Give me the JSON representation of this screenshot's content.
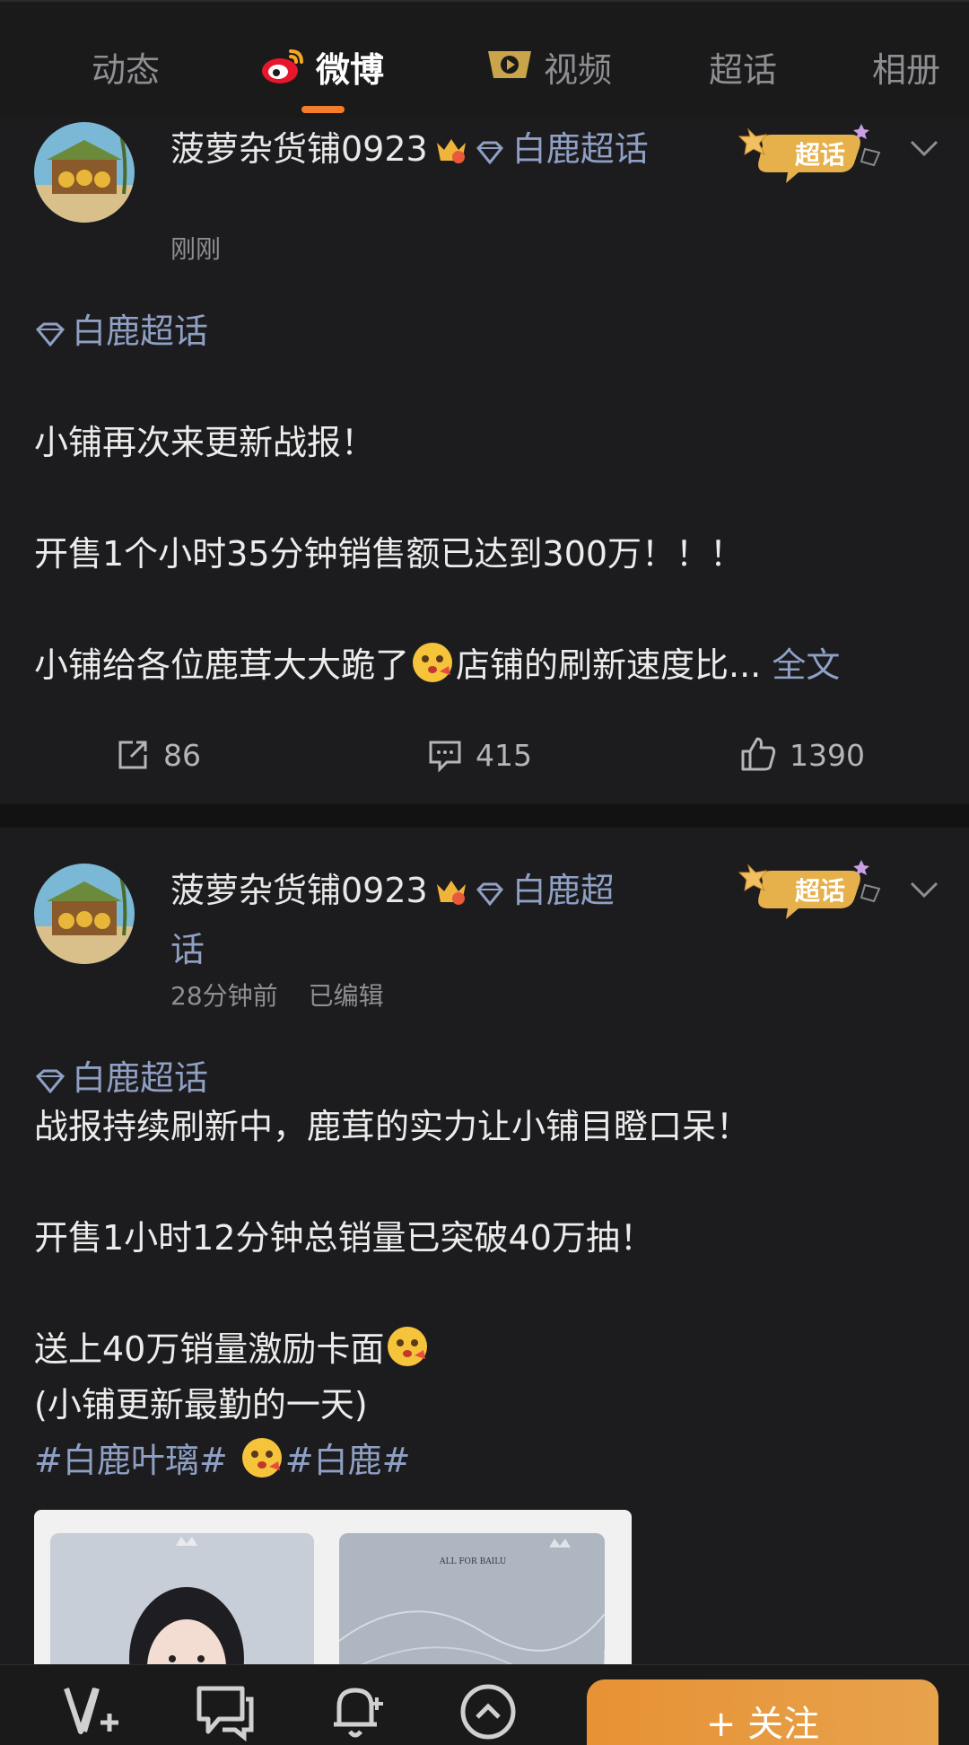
{
  "tabs": [
    {
      "label": "动态",
      "active": false
    },
    {
      "label": "微博",
      "active": true
    },
    {
      "label": "视频",
      "active": false
    },
    {
      "label": "超话",
      "active": false
    },
    {
      "label": "相册",
      "active": false
    }
  ],
  "accent_color": "#f47c2a",
  "link_color": "#8fa0c4",
  "badge_text": "超话",
  "posts": [
    {
      "username": "菠萝杂货铺0923",
      "topic_inline": "白鹿超话",
      "topic_inline_wrap": "话",
      "time": "刚刚",
      "edited": "",
      "topic": "白鹿超话",
      "lines": [
        "小铺再次来更新战报！",
        "开售1个小时35分钟销售额已达到300万！！！",
        "小铺给各位鹿茸大大跪了",
        "店铺的刷新速度比..."
      ],
      "full_text_link": "全文",
      "reposts": "86",
      "comments": "415",
      "likes": "1390"
    },
    {
      "username": "菠萝杂货铺0923",
      "topic_inline": "白鹿超",
      "topic_inline_wrap": "话",
      "time": "28分钟前",
      "edited": "已编辑",
      "topic": "白鹿超话",
      "lines": [
        "战报持续刷新中，鹿茸的实力让小铺目瞪口呆！",
        "开售1小时12分钟总销量已突破40万抽！",
        "送上40万销量激励卡面",
        "(小铺更新最勤的一天)"
      ],
      "hashtag1": "#白鹿叶璃#",
      "hashtag2": "#白鹿#"
    }
  ],
  "image_caption": "ALL FOR BAILU",
  "bottom_bar": {
    "follow_label": "+ 关注"
  }
}
